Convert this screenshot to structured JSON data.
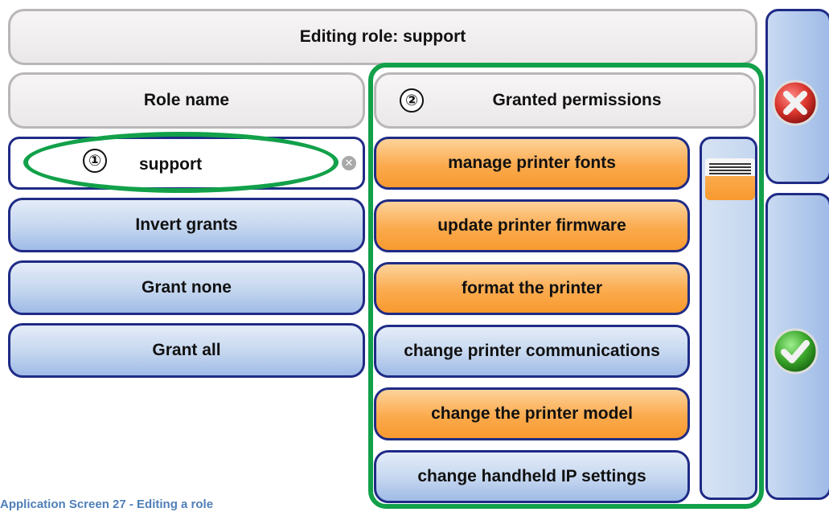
{
  "header": {
    "title": "Editing role: support"
  },
  "role_name": {
    "label": "Role name",
    "value": "support",
    "callout": "①"
  },
  "left_buttons": [
    {
      "label": "Invert grants"
    },
    {
      "label": "Grant none"
    },
    {
      "label": "Grant all"
    }
  ],
  "permissions": {
    "callout": "②",
    "header": "Granted permissions",
    "items": [
      {
        "label": "manage printer fonts",
        "granted": true
      },
      {
        "label": "update printer firmware",
        "granted": true
      },
      {
        "label": "format the printer",
        "granted": true
      },
      {
        "label": "change printer communications",
        "granted": false
      },
      {
        "label": "change the printer model",
        "granted": true
      },
      {
        "label": "change handheld IP settings",
        "granted": false
      }
    ]
  },
  "side_actions": {
    "cancel_icon": "red-x-icon",
    "confirm_icon": "green-check-icon"
  },
  "caption": "Application Screen 27 - Editing a role",
  "colors": {
    "granted": "#fbaa4d",
    "not_granted": "#c4d6ef",
    "border": "#1f2b86",
    "callout": "#12a14a"
  }
}
